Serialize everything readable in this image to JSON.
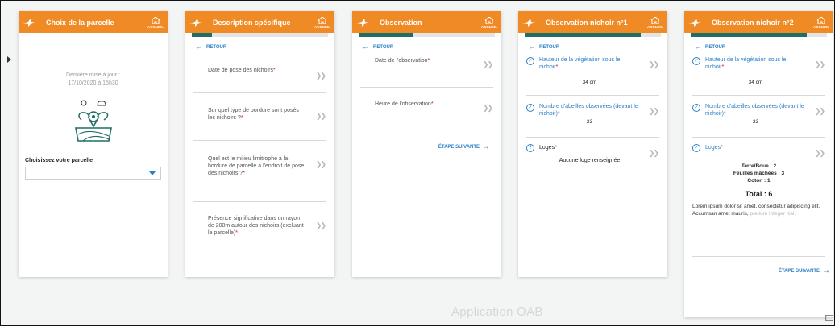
{
  "accueil_label": "ACCUEIL",
  "back_label": "RETOUR",
  "next_label": "ÉTAPE SUIVANTE",
  "footer": "Application OAB",
  "colors": {
    "header": "#f08a24",
    "progress": "#1f6f66",
    "link": "#2a7ec6",
    "required": "#c8102e"
  },
  "screens": [
    {
      "title": "Choix de la parcelle",
      "update_text": "Dernière mise à jour :\n17/10/2020 à 15h30",
      "select_label": "Choisissez votre parcelle",
      "select_value": ""
    },
    {
      "title": "Description spécifique",
      "progress": 0.15,
      "items": [
        {
          "label": "Date de pose des nichoirs",
          "required": "*"
        },
        {
          "label": "Sur quel type de bordure sont posés les nichoirs ?",
          "required": "*"
        },
        {
          "label": "Quel est le milieu limitrophe à la bordure de parcelle à l'endroit de pose des nichoirs ?",
          "required": "*"
        },
        {
          "label": "Présence significative dans un rayon de 200m autour des nichoirs (excluant la parcelle)",
          "required": "*"
        }
      ]
    },
    {
      "title": "Observation",
      "progress": 0.4,
      "items": [
        {
          "label": "Date de l'observation",
          "required": "*"
        },
        {
          "label": "Heure de l'observation",
          "required": "*"
        }
      ]
    },
    {
      "title": "Observation nichoir n°1",
      "progress": 0.85,
      "items": [
        {
          "label": "Hauteur de la végétation sous le nichoir",
          "required": "*",
          "value": "34 cm",
          "icon": "check-circle-icon"
        },
        {
          "label": "Nombre d'abeilles observées (devant le nichoir)",
          "required": "*",
          "value": "23",
          "icon": "check-circle-icon"
        },
        {
          "label": "Loges",
          "required": "*",
          "value": "Aucune loge renseignée",
          "icon": "question-circle-icon"
        }
      ]
    },
    {
      "title": "Observation nichoir n°2",
      "progress": 0.85,
      "items": [
        {
          "label": "Hauteur de la végétation sous le nichoir",
          "required": "*",
          "value": "34 cm",
          "icon": "check-circle-icon"
        },
        {
          "label": "Nombre d'abeilles observées (devant le nichoir)",
          "required": "*",
          "value": "23",
          "icon": "check-circle-icon"
        },
        {
          "label": "Loges",
          "required": "*",
          "icon": "check-circle-icon"
        }
      ],
      "loges_lines": [
        "Terre/Boue : 2",
        "Feuilles mâchées : 3",
        "Coton : 1"
      ],
      "total": "Total : 6",
      "lorem": "Lorem ipsum dolor sit amet, consectetur adipiscing elit. Accumsan amet mauris, ",
      "lorem_faded": "pretium integer nisl."
    }
  ]
}
